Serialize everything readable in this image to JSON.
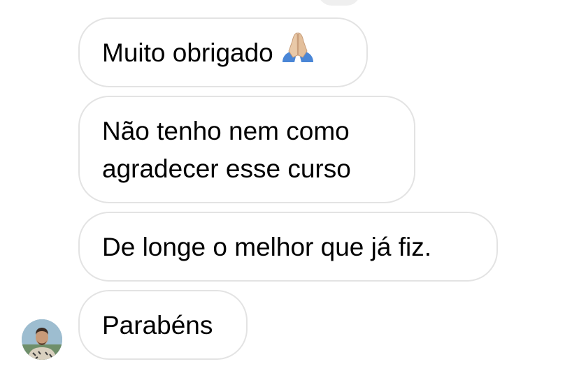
{
  "messages": [
    {
      "text": "Muito obrigado",
      "emoji": "praying-hands"
    },
    {
      "line1": "Não tenho nem como",
      "line2": "agradecer esse curso"
    },
    {
      "text": "De longe o melhor que já fiz."
    },
    {
      "text": "Parabéns"
    }
  ],
  "colors": {
    "bubble_border": "#e3e3e3",
    "bubble_bg": "#ffffff",
    "text": "#000000"
  }
}
